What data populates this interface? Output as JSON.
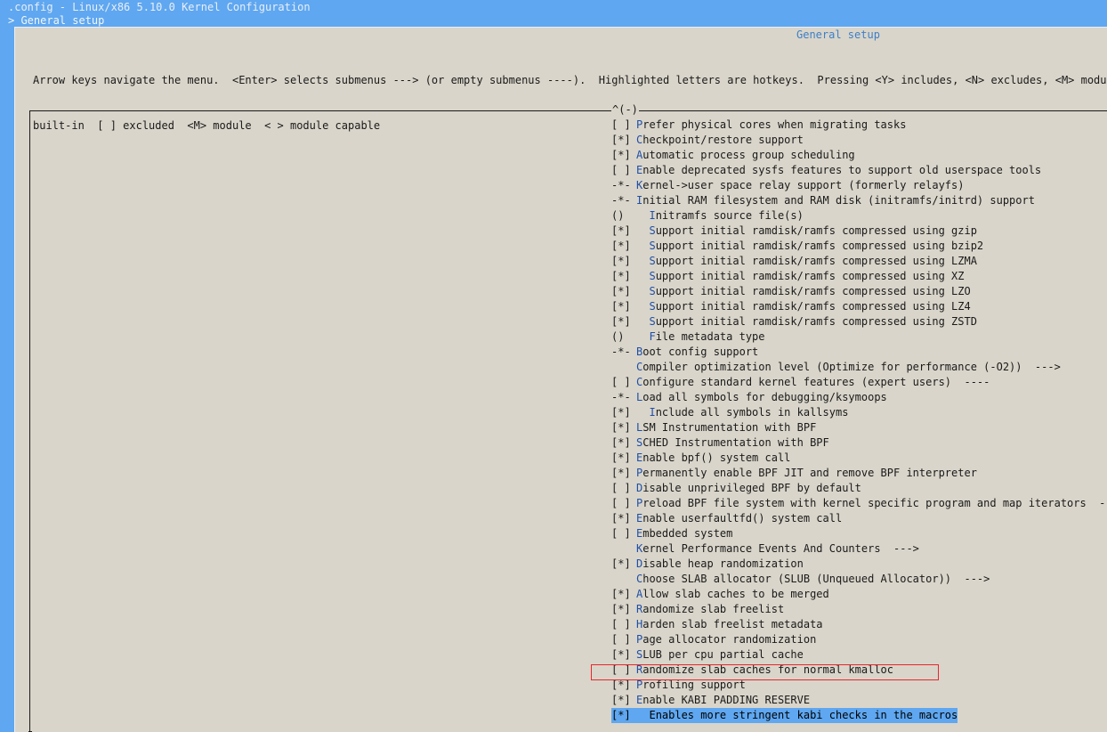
{
  "window": {
    "title": ".config - Linux/x86 5.10.0 Kernel Configuration",
    "breadcrumb": "> General setup"
  },
  "panel": {
    "title": "General setup",
    "help_line_1": "Arrow keys navigate the menu.  <Enter> selects submenus ---> (or empty submenus ----).  Highlighted letters are hotkeys.  Pressing <Y> includes, <N> excludes, <M> modularize",
    "help_line_2": "built-in  [ ] excluded  <M> module  < > module capable",
    "scroll_indicator": "^(-)"
  },
  "menu": {
    "items": [
      {
        "mark": "[ ]",
        "label": "Prefer physical cores when migrating tasks"
      },
      {
        "mark": "[*]",
        "label": "Checkpoint/restore support"
      },
      {
        "mark": "[*]",
        "label": "Automatic process group scheduling"
      },
      {
        "mark": "[ ]",
        "label": "Enable deprecated sysfs features to support old userspace tools"
      },
      {
        "mark": "-*-",
        "label": "Kernel->user space relay support (formerly relayfs)"
      },
      {
        "mark": "-*-",
        "label": "Initial RAM filesystem and RAM disk (initramfs/initrd) support"
      },
      {
        "mark": "()",
        "label": "  Initramfs source file(s)"
      },
      {
        "mark": "[*]",
        "label": "  Support initial ramdisk/ramfs compressed using gzip"
      },
      {
        "mark": "[*]",
        "label": "  Support initial ramdisk/ramfs compressed using bzip2"
      },
      {
        "mark": "[*]",
        "label": "  Support initial ramdisk/ramfs compressed using LZMA"
      },
      {
        "mark": "[*]",
        "label": "  Support initial ramdisk/ramfs compressed using XZ"
      },
      {
        "mark": "[*]",
        "label": "  Support initial ramdisk/ramfs compressed using LZO"
      },
      {
        "mark": "[*]",
        "label": "  Support initial ramdisk/ramfs compressed using LZ4"
      },
      {
        "mark": "[*]",
        "label": "  Support initial ramdisk/ramfs compressed using ZSTD"
      },
      {
        "mark": "()",
        "label": "  File metadata type"
      },
      {
        "mark": "-*-",
        "label": "Boot config support"
      },
      {
        "mark": "",
        "label": "Compiler optimization level (Optimize for performance (-O2))  --->"
      },
      {
        "mark": "[ ]",
        "label": "Configure standard kernel features (expert users)  ----"
      },
      {
        "mark": "-*-",
        "label": "Load all symbols for debugging/ksymoops"
      },
      {
        "mark": "[*]",
        "label": "  Include all symbols in kallsyms"
      },
      {
        "mark": "[*]",
        "label": "LSM Instrumentation with BPF"
      },
      {
        "mark": "[*]",
        "label": "SCHED Instrumentation with BPF"
      },
      {
        "mark": "[*]",
        "label": "Enable bpf() system call"
      },
      {
        "mark": "[*]",
        "label": "Permanently enable BPF JIT and remove BPF interpreter"
      },
      {
        "mark": "[ ]",
        "label": "Disable unprivileged BPF by default"
      },
      {
        "mark": "[ ]",
        "label": "Preload BPF file system with kernel specific program and map iterators  ----"
      },
      {
        "mark": "[*]",
        "label": "Enable userfaultfd() system call"
      },
      {
        "mark": "[ ]",
        "label": "Embedded system"
      },
      {
        "mark": "",
        "label": "Kernel Performance Events And Counters  --->"
      },
      {
        "mark": "[*]",
        "label": "Disable heap randomization"
      },
      {
        "mark": "",
        "label": "Choose SLAB allocator (SLUB (Unqueued Allocator))  --->"
      },
      {
        "mark": "[*]",
        "label": "Allow slab caches to be merged"
      },
      {
        "mark": "[*]",
        "label": "Randomize slab freelist"
      },
      {
        "mark": "[ ]",
        "label": "Harden slab freelist metadata"
      },
      {
        "mark": "[ ]",
        "label": "Page allocator randomization"
      },
      {
        "mark": "[*]",
        "label": "SLUB per cpu partial cache"
      },
      {
        "mark": "[ ]",
        "label": "Randomize slab caches for normal kmalloc"
      },
      {
        "mark": "[*]",
        "label": "Profiling support"
      },
      {
        "mark": "[*]",
        "label": "Enable KABI PADDING RESERVE"
      },
      {
        "mark": "[*]",
        "label": "  Enables more stringent kabi checks in the macros"
      }
    ],
    "selected_index": 39,
    "annotated_index": 36
  },
  "colors": {
    "terminal_blue": "#5fa7f0",
    "panel_background": "#d9d5ca",
    "hotkey": "#1f4fa8",
    "annotation_red": "#e8262d"
  }
}
